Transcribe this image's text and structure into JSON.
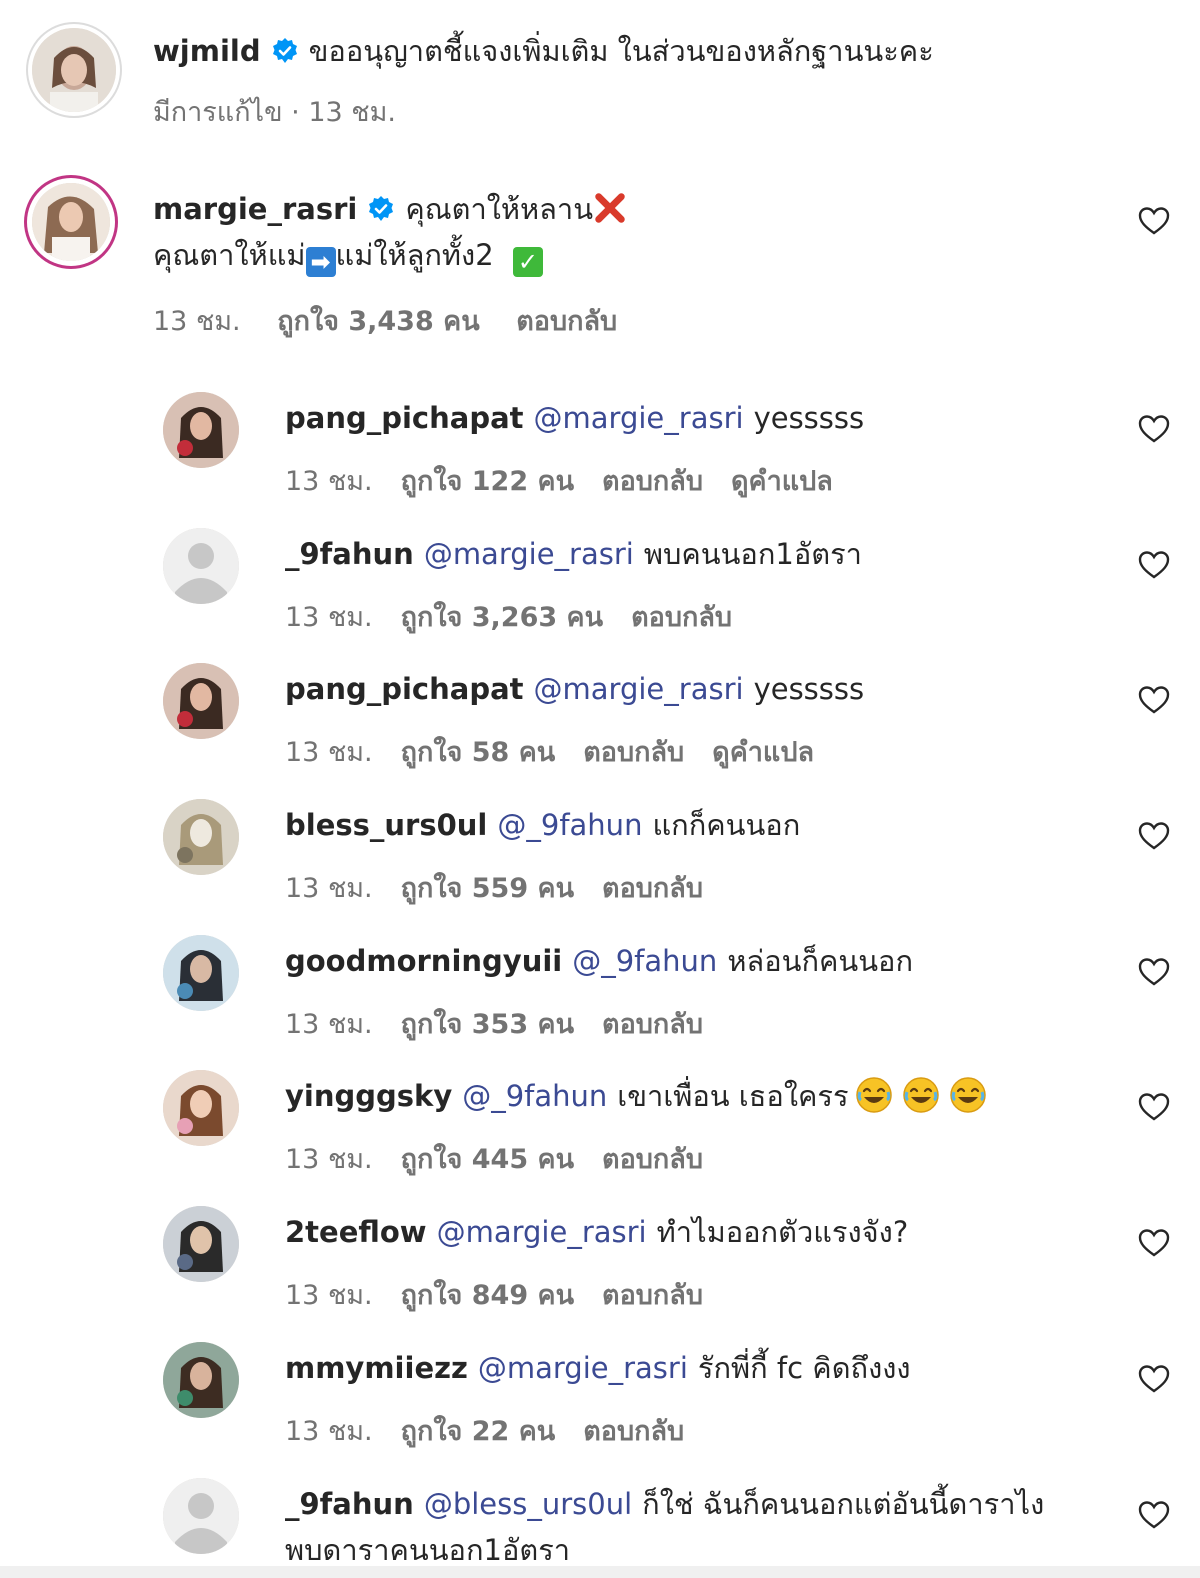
{
  "post_caption": {
    "username": "wjmild",
    "verified": true,
    "text": "ขออนุญาตชี้แจงเพิ่มเติม ในส่วนของหลักฐานนะคะ",
    "edited_label": "มีการแก้ไข · 13 ชม."
  },
  "main_comment": {
    "username": "margie_rasri",
    "verified": true,
    "line1": "คุณตาให้หลาน",
    "line2a": "คุณตาให้แม่",
    "line2b": "แม่ให้ลูกทั้ง2",
    "time": "13 ชม.",
    "likes": "ถูกใจ 3,438 คน",
    "reply": "ตอบกลับ",
    "icons": [
      "cross-mark-icon",
      "right-arrow-icon",
      "check-mark-icon"
    ]
  },
  "replies": [
    {
      "username": "pang_pichapat",
      "mention": "@margie_rasri",
      "text": "yesssss",
      "time": "13 ชม.",
      "likes": "ถูกใจ 122 คน",
      "reply": "ตอบกลับ",
      "translate": "ดูคำแปล"
    },
    {
      "username": "_9fahun",
      "mention": "@margie_rasri",
      "text": "พบคนนอก1อัตรา",
      "time": "13 ชม.",
      "likes": "ถูกใจ 3,263 คน",
      "reply": "ตอบกลับ"
    },
    {
      "username": "pang_pichapat",
      "mention": "@margie_rasri",
      "text": "yesssss",
      "time": "13 ชม.",
      "likes": "ถูกใจ 58 คน",
      "reply": "ตอบกลับ",
      "translate": "ดูคำแปล"
    },
    {
      "username": "bless_urs0ul",
      "mention": "@_9fahun",
      "text": "แกก็คนนอก",
      "time": "13 ชม.",
      "likes": "ถูกใจ 559 คน",
      "reply": "ตอบกลับ"
    },
    {
      "username": "goodmorningyuii",
      "mention": "@_9fahun",
      "text": "หล่อนก็คนนอก",
      "time": "13 ชม.",
      "likes": "ถูกใจ 353 คน",
      "reply": "ตอบกลับ"
    },
    {
      "username": "yingggsky",
      "mention": "@_9fahun",
      "text": "เขาเพื่อน เธอใครร",
      "time": "13 ชม.",
      "likes": "ถูกใจ 445 คน",
      "reply": "ตอบกลับ"
    },
    {
      "username": "2teeflow",
      "mention": "@margie_rasri",
      "text": "ทำไมออกตัวแรงจัง?",
      "time": "13 ชม.",
      "likes": "ถูกใจ 849 คน",
      "reply": "ตอบกลับ"
    },
    {
      "username": "mmymiiezz",
      "mention": "@margie_rasri",
      "text": "รักพี่กี้ fc คิดถึงงง",
      "time": "13 ชม.",
      "likes": "ถูกใจ 22 คน",
      "reply": "ตอบกลับ"
    },
    {
      "username": "_9fahun",
      "mention": "@bless_urs0ul",
      "text": "ก็ใช่ ฉันก็คนนอกแต่อันนี้ดาราไง",
      "text2": "พบดาราคนนอก1อัตรา"
    }
  ],
  "colors": {
    "text": "#262626",
    "muted": "#737373",
    "mention": "#3b4a93",
    "verified": "#0095f6",
    "story_ring": "#c13584"
  }
}
